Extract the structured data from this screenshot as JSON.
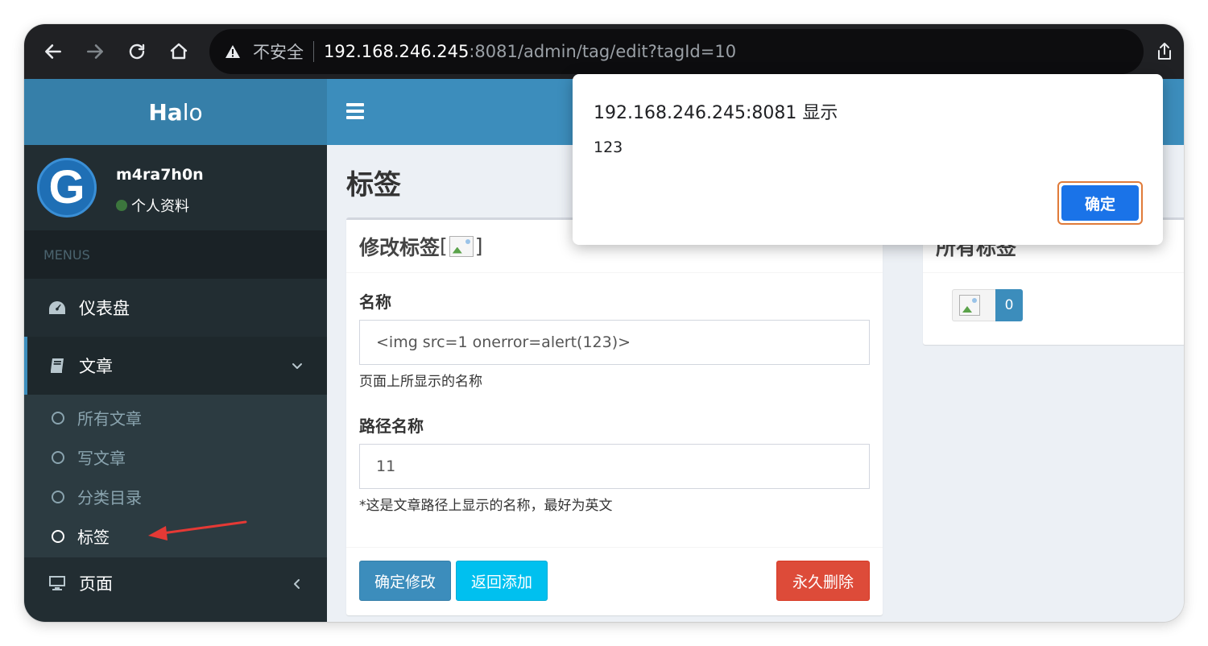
{
  "browser": {
    "insecure_label": "不安全",
    "url_host": "192.168.246.245",
    "url_rest": ":8081/admin/tag/edit?tagId=10",
    "icons": [
      "back-icon",
      "forward-icon",
      "reload-icon",
      "home-icon",
      "warning-icon",
      "share-icon"
    ]
  },
  "brand": {
    "logo_bold": "Ha",
    "logo_light": "lo"
  },
  "user": {
    "avatar_letter": "G",
    "name": "m4ra7h0n",
    "profile_link": "个人资料",
    "status_color": "#3c763d"
  },
  "sidebar": {
    "menus_header": "MENUS",
    "items": [
      {
        "label": "仪表盘",
        "icon": "dashboard-icon"
      },
      {
        "label": "文章",
        "icon": "book-icon",
        "active": true
      },
      {
        "label": "页面",
        "icon": "desktop-icon"
      }
    ],
    "submenu": [
      {
        "label": "所有文章"
      },
      {
        "label": "写文章"
      },
      {
        "label": "分类目录"
      },
      {
        "label": "标签",
        "current": true
      }
    ]
  },
  "page": {
    "title": "标签"
  },
  "edit_box": {
    "title": "修改标签",
    "title_bracket_open": "[",
    "title_bracket_close": "]",
    "name_label": "名称",
    "name_value": "<img src=1 onerror=alert(123)>",
    "name_help": "页面上所显示的名称",
    "slug_label": "路径名称",
    "slug_value": "11",
    "slug_help": "*这是文章路径上显示的名称，最好为英文",
    "btn_confirm": "确定修改",
    "btn_back": "返回添加",
    "btn_delete": "永久删除"
  },
  "tags_box": {
    "title": "所有标签",
    "tag_count": "0"
  },
  "dialog": {
    "title": "192.168.246.245:8081 显示",
    "message": "123",
    "ok_label": "确定"
  },
  "colors": {
    "sidebar_bg": "#222d32",
    "brand_blue": "#3c8dbc",
    "logo_bg": "#367fa9",
    "danger": "#dd4b39",
    "info": "#00c0ef",
    "dialog_ok": "#1a73e8",
    "annotation_arrow": "#e53935"
  }
}
